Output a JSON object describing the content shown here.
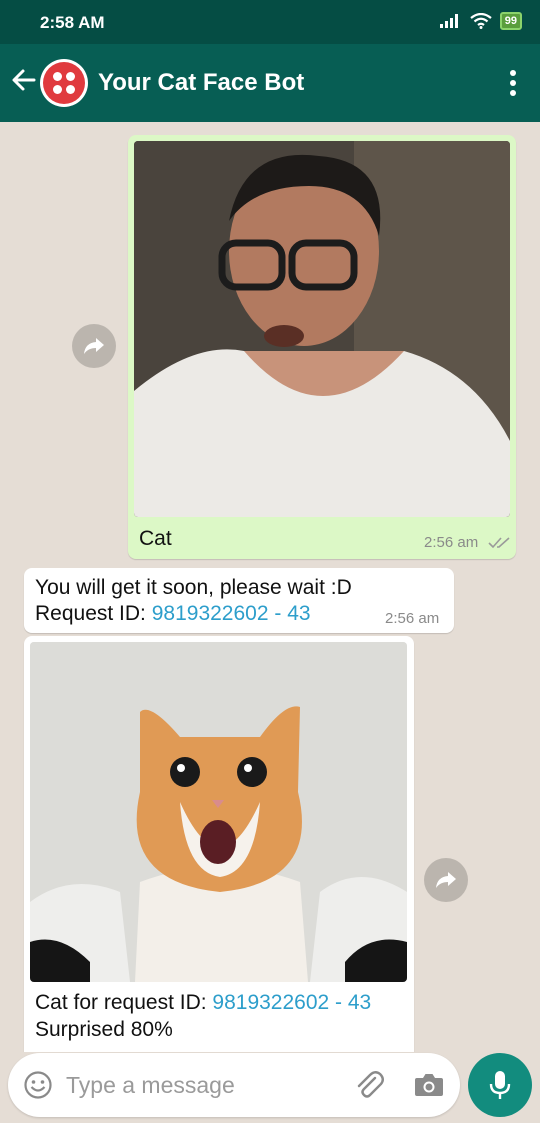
{
  "status": {
    "time": "2:58 AM",
    "battery": "99"
  },
  "header": {
    "title": "Your Cat Face Bot"
  },
  "messages": {
    "sent_image": {
      "caption": "Cat",
      "time": "2:56 am",
      "ticks_icon": "double-check-icon"
    },
    "reply_text": {
      "line1": "You will get it soon, please wait :D",
      "line2_label": "Request ID: ",
      "line2_link": "9819322602 - 43",
      "time": "2:56 am"
    },
    "cat_image": {
      "caption_label": "Cat for request ID: ",
      "caption_link": "9819322602 - 43",
      "emotion": "Surprised 80%"
    }
  },
  "composer": {
    "placeholder": "Type a message"
  },
  "colors": {
    "header": "#075e54",
    "statusbar": "#054d44",
    "outgoing": "#dcf8c6",
    "incoming": "#ffffff",
    "link": "#2d9ecb",
    "mic": "#128c7e"
  }
}
